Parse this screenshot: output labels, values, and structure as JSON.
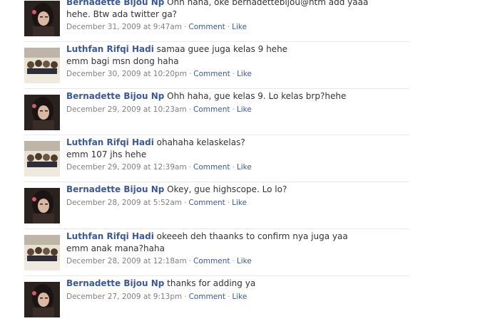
{
  "feed": {
    "posts": [
      {
        "author": "",
        "avatar": "bernadette-avatar",
        "lines": [
          "Ohh haha, oke bernadettebijou@htm add yaaa",
          "hehe. Btw ada twitter ga?"
        ],
        "timestamp": "December 31, 2009 at 9:47am",
        "comment_label": "Comment",
        "like_label": "Like"
      },
      {
        "author": "Luthfan Rifqi Hadi",
        "avatar": "luthfan-avatar",
        "lines": [
          "samaa guee juga kelas 9 hehe",
          "emm bagi msn dong haha"
        ],
        "timestamp": "December 30, 2009 at 10:20pm",
        "comment_label": "Comment",
        "like_label": "Like"
      },
      {
        "author": "Bernadette Bijou Np",
        "avatar": "bernadette-avatar",
        "lines": [
          "Ohh haha, gue kelas 9. Lo kelas brp?hehe"
        ],
        "timestamp": "December 29, 2009 at 10:23am",
        "comment_label": "Comment",
        "like_label": "Like"
      },
      {
        "author": "Luthfan Rifqi Hadi",
        "avatar": "luthfan-avatar",
        "lines": [
          "ohahaha kelaskelas?",
          "emm 107 jhs hehe"
        ],
        "timestamp": "December 29, 2009 at 12:39am",
        "comment_label": "Comment",
        "like_label": "Like"
      },
      {
        "author": "Bernadette Bijou Np",
        "avatar": "bernadette-avatar",
        "lines": [
          "Okey, gue highscope. Lo lo?"
        ],
        "timestamp": "December 28, 2009 at 5:52am",
        "comment_label": "Comment",
        "like_label": "Like"
      },
      {
        "author": "Luthfan Rifqi Hadi",
        "avatar": "luthfan-avatar",
        "lines": [
          "okeeeh deh thaanks to confirm nya juga yaa",
          "emm anak mana?haha"
        ],
        "timestamp": "December 28, 2009 at 12:18am",
        "comment_label": "Comment",
        "like_label": "Like"
      },
      {
        "author": "Bernadette Bijou Np",
        "avatar": "bernadette-avatar",
        "lines": [
          "thanks for adding ya"
        ],
        "timestamp": "December 27, 2009 at 9:13pm",
        "comment_label": "Comment",
        "like_label": "Like"
      }
    ]
  },
  "first_post_author_partial": "Bernadette Bijou Np"
}
